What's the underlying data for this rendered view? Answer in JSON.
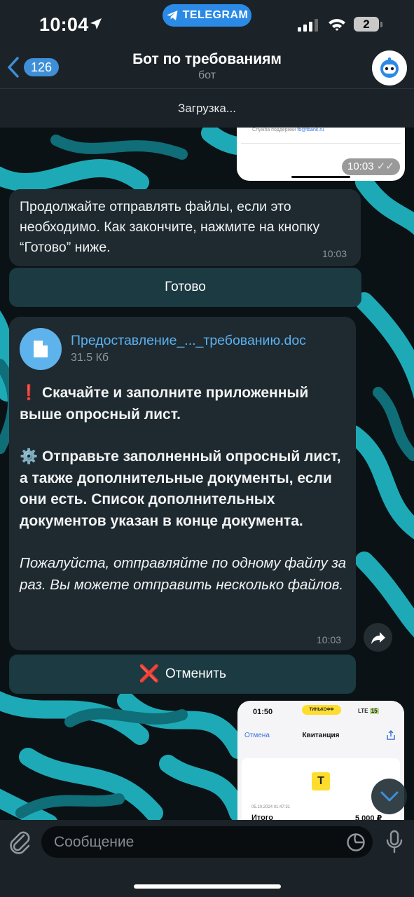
{
  "status_bar": {
    "time": "10:04",
    "pill_label": "TELEGRAM",
    "battery": "2"
  },
  "header": {
    "back_badge": "126",
    "title": "Бот по требованиям",
    "subtitle": "бот",
    "loading": "Загрузка..."
  },
  "screenshot_top": {
    "support_label": "Служба поддержки",
    "support_email": "fb@tbank.ru",
    "time": "10:03"
  },
  "messages": {
    "m1": {
      "text": "Продолжайте отправлять файлы, если это необходимо. Как закончите, нажмите на кнопку “Готово” ниже.",
      "time": "10:03",
      "button": "Готово"
    },
    "m2": {
      "file_name": "Предоставление_..._требованию.doc",
      "file_size": "31.5 Кб",
      "p1": "Скачайте и заполните приложенный выше опросный лист.",
      "p2": "Отправьте заполненный опросный лист, а также дополнительные документы, если они есть. Список дополнительных документов указан в конце документа.",
      "p3": "Пожалуйста, отправляйте по одному файлу за раз. Вы можете отправить несколько файлов.",
      "time": "10:03",
      "button": "Отменить"
    }
  },
  "screenshot_bottom": {
    "time": "01:50",
    "bank_pill": "ТИНЬКОФФ",
    "network": "LTE",
    "battery": "15",
    "cancel": "Отмена",
    "title": "Квитанция",
    "logo": "Т",
    "date": "05.10.2024 01:47:31",
    "total_label": "Итого",
    "total_value": "5 000 ₽"
  },
  "input": {
    "placeholder": "Сообщение"
  },
  "colors": {
    "accent": "#3e8fd8",
    "bubble": "#1f2a30",
    "keyboard_button": "#1b3a42",
    "bg_teal": "#1fb7c4"
  }
}
